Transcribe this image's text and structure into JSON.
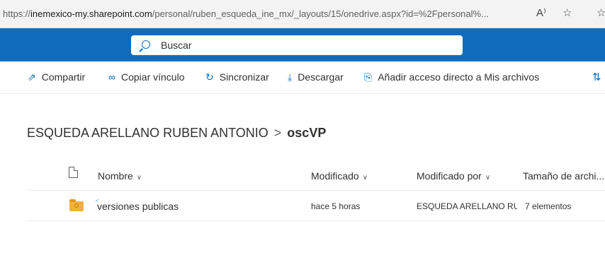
{
  "browser": {
    "url_prefix": "https://",
    "url_host": "inemexico-my.sharepoint.com",
    "url_path": "/personal/ruben_esqueda_ine_mx/_layouts/15/onedrive.aspx?id=%2Fpersonal%...",
    "read_aloud_icon": "A⁾",
    "favorites_icon": "☆",
    "collections_icon": "☆"
  },
  "search": {
    "placeholder": "Buscar"
  },
  "commands": [
    {
      "label": "Compartir",
      "icon": "share-icon",
      "glyph": "⇗"
    },
    {
      "label": "Copiar vínculo",
      "icon": "link-icon",
      "glyph": "∞"
    },
    {
      "label": "Sincronizar",
      "icon": "sync-icon",
      "glyph": "↻"
    },
    {
      "label": "Descargar",
      "icon": "download-icon",
      "glyph": "⤓"
    },
    {
      "label": "Añadir acceso directo a Mis archivos",
      "icon": "add-shortcut-icon",
      "glyph": "⎘"
    }
  ],
  "sort_glyph": "⇅",
  "breadcrumb": {
    "parent": "ESQUEDA ARELLANO RUBEN ANTONIO",
    "separator": ">",
    "current": "oscVP"
  },
  "table": {
    "columns": [
      "Nombre",
      "Modificado",
      "Modificado por",
      "Tamaño de archi..."
    ],
    "chevron": "∨",
    "rows": [
      {
        "name": "versiones publicas",
        "modified": "hace 5 horas",
        "modified_by": "ESQUEDA ARELLANO RUB",
        "size": "7 elementos"
      }
    ]
  },
  "colors": {
    "brand": "#0f6cbd",
    "folder": "#f2b03d"
  }
}
